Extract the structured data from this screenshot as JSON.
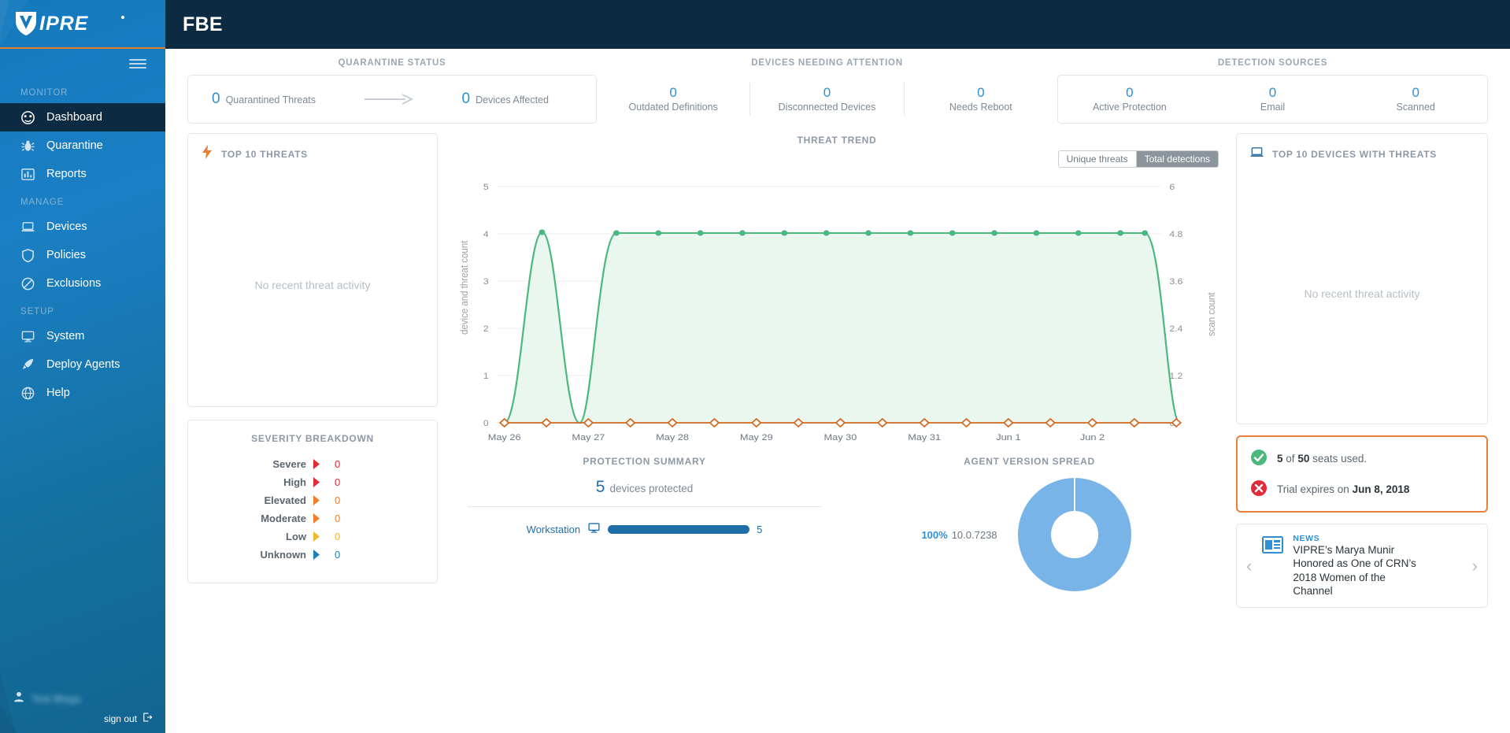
{
  "brand": {
    "logo_text": "VIPRE"
  },
  "topbar": {
    "title": "FBE"
  },
  "sidebar": {
    "sections": [
      {
        "label": "MONITOR",
        "items": [
          {
            "label": "Dashboard",
            "icon": "dashboard-icon",
            "active": true
          },
          {
            "label": "Quarantine",
            "icon": "bug-icon",
            "active": false
          },
          {
            "label": "Reports",
            "icon": "bar-chart-icon",
            "active": false
          }
        ]
      },
      {
        "label": "MANAGE",
        "items": [
          {
            "label": "Devices",
            "icon": "laptop-icon",
            "active": false
          },
          {
            "label": "Policies",
            "icon": "shield-icon",
            "active": false
          },
          {
            "label": "Exclusions",
            "icon": "no-entry-icon",
            "active": false
          }
        ]
      },
      {
        "label": "SETUP",
        "items": [
          {
            "label": "System",
            "icon": "monitor-icon",
            "active": false
          },
          {
            "label": "Deploy Agents",
            "icon": "rocket-icon",
            "active": false
          },
          {
            "label": "Help",
            "icon": "globe-icon",
            "active": false
          }
        ]
      }
    ],
    "user_name": "Test Blogs",
    "sign_out": "sign out"
  },
  "kpis": {
    "quarantine": {
      "title": "QUARANTINE STATUS",
      "threats_value": "0",
      "threats_label": "Quarantined Threats",
      "devices_value": "0",
      "devices_label": "Devices Affected"
    },
    "attention": {
      "title": "DEVICES NEEDING ATTENTION",
      "cells": [
        {
          "value": "0",
          "label": "Outdated Definitions"
        },
        {
          "value": "0",
          "label": "Disconnected Devices"
        },
        {
          "value": "0",
          "label": "Needs Reboot"
        }
      ]
    },
    "detection": {
      "title": "DETECTION SOURCES",
      "cells": [
        {
          "value": "0",
          "label": "Active Protection"
        },
        {
          "value": "0",
          "label": "Email"
        },
        {
          "value": "0",
          "label": "Scanned"
        }
      ]
    }
  },
  "top_threats": {
    "title": "TOP 10 THREATS",
    "empty": "No recent threat activity"
  },
  "top_devices": {
    "title": "TOP 10 DEVICES WITH THREATS",
    "empty": "No recent threat activity"
  },
  "severity": {
    "title": "SEVERITY BREAKDOWN",
    "rows": [
      {
        "label": "Severe",
        "value": "0",
        "color": "#e02c38"
      },
      {
        "label": "High",
        "value": "0",
        "color": "#e02c38"
      },
      {
        "label": "Elevated",
        "value": "0",
        "color": "#ef7f2a"
      },
      {
        "label": "Moderate",
        "value": "0",
        "color": "#ef7f2a"
      },
      {
        "label": "Low",
        "value": "0",
        "color": "#f2b630"
      },
      {
        "label": "Unknown",
        "value": "0",
        "color": "#1c7fb8"
      }
    ]
  },
  "trend": {
    "title": "THREAT TREND",
    "toggle": {
      "unique": "Unique threats",
      "total": "Total detections",
      "selected": "Total detections"
    }
  },
  "chart_data": {
    "type": "line",
    "title": "THREAT TREND",
    "xlabel": "",
    "ylabel": "device and threat count",
    "y2label": "scan count",
    "ylim": [
      0,
      5
    ],
    "y2lim": [
      0,
      6
    ],
    "yticks": [
      0,
      1,
      2,
      3,
      4,
      5
    ],
    "y2ticks": [
      "0",
      "1.2",
      "2.4",
      "3.6",
      "4.8",
      "6"
    ],
    "grid": true,
    "legend": "none",
    "x": [
      "May 26",
      "May 26.5",
      "May 27",
      "May 27.5",
      "May 28",
      "May 28.5",
      "May 29",
      "May 29.5",
      "May 30",
      "May 30.5",
      "May 31",
      "May 31.5",
      "Jun 1",
      "Jun 1.5",
      "Jun 2",
      "Jun 2.5"
    ],
    "tick_labels": [
      "May 26",
      "",
      "May 27",
      "",
      "May 28",
      "",
      "May 29",
      "",
      "May 30",
      "",
      "May 31",
      "",
      "Jun 1",
      "",
      "Jun 2",
      ""
    ],
    "series": [
      {
        "name": "device and threat count",
        "color": "#4cb87e",
        "fill": "#eaf7ef",
        "values": [
          0,
          4.2,
          0,
          4.2,
          4.2,
          4.2,
          4.2,
          4.2,
          4.2,
          4.2,
          4.2,
          4.2,
          4.2,
          4.2,
          0,
          0
        ]
      },
      {
        "name": "scan count",
        "color": "#d2691e",
        "fill": "none",
        "values": [
          0,
          0,
          0,
          0,
          0,
          0,
          0,
          0,
          0,
          0,
          0,
          0,
          0,
          0,
          0,
          0
        ]
      }
    ]
  },
  "protection": {
    "title": "PROTECTION SUMMARY",
    "count": "5",
    "count_label": "devices protected",
    "rows": [
      {
        "label": "Workstation",
        "icon": "monitor-icon",
        "value": "5",
        "bar_pct": 100
      }
    ]
  },
  "agent_version": {
    "title": "AGENT VERSION SPREAD",
    "slices": [
      {
        "label": "10.0.7238",
        "pct": "100%",
        "color": "#79b4e8"
      }
    ]
  },
  "license": {
    "seats_used": "5",
    "seats_total": "50",
    "seats_prefix": "",
    "seats_mid": "of",
    "seats_suffix": "seats used.",
    "trial_text": "Trial expires on",
    "trial_date": "Jun 8, 2018"
  },
  "news": {
    "kicker": "NEWS",
    "headline": "VIPRE’s Marya Munir Honored as One of CRN’s 2018 Women of the Channel",
    "prev": "‹",
    "next": "›"
  }
}
